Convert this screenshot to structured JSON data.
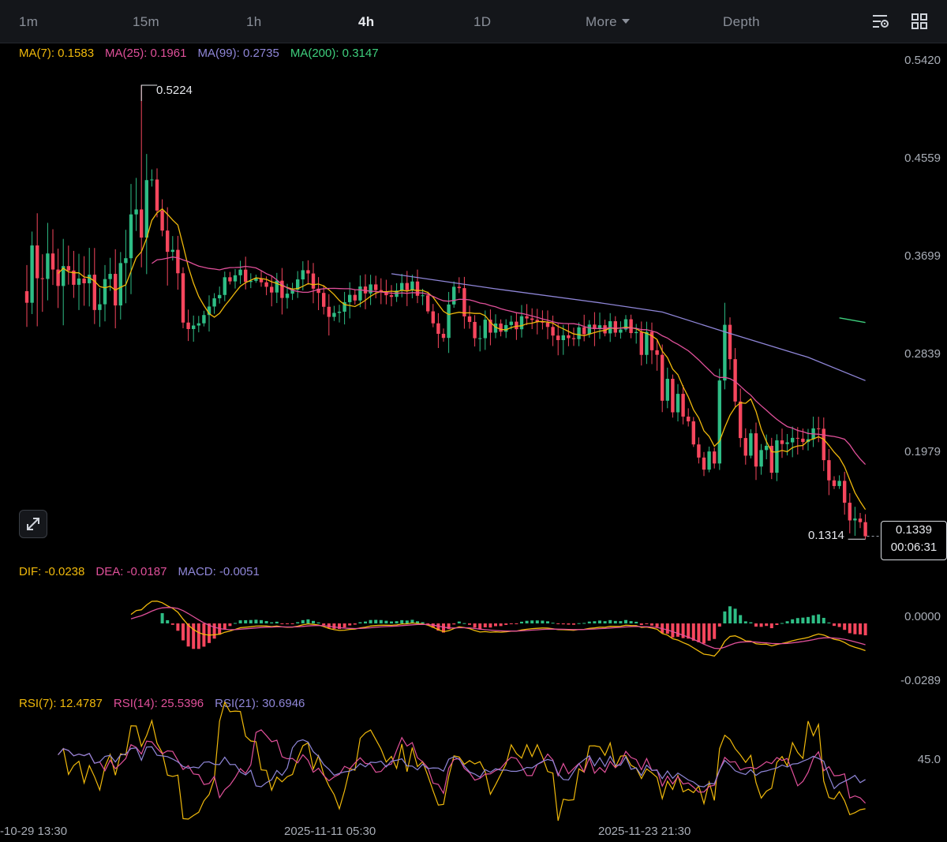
{
  "toolbar": {
    "tabs": [
      "1m",
      "15m",
      "1h",
      "4h",
      "1D"
    ],
    "active_tab": "4h",
    "more_label": "More",
    "depth_label": "Depth"
  },
  "legends": {
    "ma": [
      {
        "label": "MA(7): 0.1583",
        "color": "#f0b90b"
      },
      {
        "label": "MA(25): 0.1961",
        "color": "#e0509a"
      },
      {
        "label": "MA(99): 0.2735",
        "color": "#8f86d8"
      },
      {
        "label": "MA(200): 0.3147",
        "color": "#3ecf7d"
      }
    ],
    "macd": [
      {
        "label": "DIF: -0.0238",
        "color": "#f0b90b"
      },
      {
        "label": "DEA: -0.0187",
        "color": "#e0509a"
      },
      {
        "label": "MACD: -0.0051",
        "color": "#8f86d8"
      }
    ],
    "rsi": [
      {
        "label": "RSI(7): 12.4787",
        "color": "#f0b90b"
      },
      {
        "label": "RSI(14): 25.5396",
        "color": "#e0509a"
      },
      {
        "label": "RSI(21): 30.6946",
        "color": "#8f86d8"
      }
    ]
  },
  "price_axis": [
    "0.5420",
    "0.4559",
    "0.3699",
    "0.2839",
    "0.1979"
  ],
  "macd_axis": [
    "0.0000",
    "-0.0289"
  ],
  "rsi_axis": [
    "45.0"
  ],
  "time_axis": [
    "-10-29 13:30",
    "2025-11-11 05:30",
    "2025-11-23 21:30"
  ],
  "markers": {
    "high": "0.5224",
    "low": "0.1314",
    "last_price": "0.1339",
    "countdown": "00:06:31"
  },
  "colors": {
    "up": "#2ebd85",
    "down": "#f6465d",
    "background": "#000000"
  },
  "chart_data": {
    "type": "candlestick",
    "title": "",
    "interval": "4h",
    "price_range": [
      0.12,
      0.555
    ],
    "grid": false,
    "indicators": [
      "MA(7)",
      "MA(25)",
      "MA(99)",
      "MA(200)",
      "MACD",
      "RSI(7)",
      "RSI(14)",
      "RSI(21)"
    ],
    "price_path": [
      [
        0,
        0.36
      ],
      [
        3,
        0.37
      ],
      [
        8,
        0.35
      ],
      [
        14,
        0.34
      ],
      [
        18,
        0.36
      ],
      [
        20,
        0.39
      ],
      [
        22,
        0.41
      ],
      [
        23,
        0.44
      ],
      [
        24,
        0.42
      ],
      [
        26,
        0.39
      ],
      [
        28,
        0.36
      ],
      [
        30,
        0.32
      ],
      [
        32,
        0.31
      ],
      [
        34,
        0.33
      ],
      [
        36,
        0.34
      ],
      [
        38,
        0.35
      ],
      [
        42,
        0.36
      ],
      [
        46,
        0.35
      ],
      [
        50,
        0.345
      ],
      [
        54,
        0.36
      ],
      [
        56,
        0.345
      ],
      [
        58,
        0.325
      ],
      [
        60,
        0.33
      ],
      [
        62,
        0.34
      ],
      [
        66,
        0.345
      ],
      [
        70,
        0.34
      ],
      [
        74,
        0.35
      ],
      [
        76,
        0.34
      ],
      [
        78,
        0.32
      ],
      [
        80,
        0.3
      ],
      [
        82,
        0.355
      ],
      [
        84,
        0.33
      ],
      [
        86,
        0.31
      ],
      [
        90,
        0.315
      ],
      [
        94,
        0.318
      ],
      [
        100,
        0.31
      ],
      [
        106,
        0.312
      ],
      [
        112,
        0.313
      ],
      [
        116,
        0.315
      ],
      [
        118,
        0.305
      ],
      [
        120,
        0.29
      ],
      [
        122,
        0.265
      ],
      [
        124,
        0.25
      ],
      [
        126,
        0.235
      ],
      [
        128,
        0.22
      ],
      [
        130,
        0.2
      ],
      [
        132,
        0.21
      ],
      [
        134,
        0.31
      ],
      [
        136,
        0.25
      ],
      [
        138,
        0.215
      ],
      [
        140,
        0.205
      ],
      [
        142,
        0.2
      ],
      [
        144,
        0.205
      ],
      [
        146,
        0.2
      ],
      [
        148,
        0.21
      ],
      [
        150,
        0.225
      ],
      [
        152,
        0.215
      ],
      [
        154,
        0.19
      ],
      [
        156,
        0.17
      ],
      [
        158,
        0.152
      ],
      [
        160,
        0.139
      ],
      [
        161,
        0.1339
      ]
    ],
    "ma99_path": [
      [
        70,
        0.36
      ],
      [
        90,
        0.347
      ],
      [
        110,
        0.335
      ],
      [
        122,
        0.327
      ],
      [
        134,
        0.31
      ],
      [
        150,
        0.288
      ],
      [
        161,
        0.268
      ]
    ],
    "ma200_path": [
      [
        156,
        0.322
      ],
      [
        161,
        0.318
      ]
    ],
    "high": 0.5224,
    "low": 0.1314,
    "last": 0.1339
  }
}
